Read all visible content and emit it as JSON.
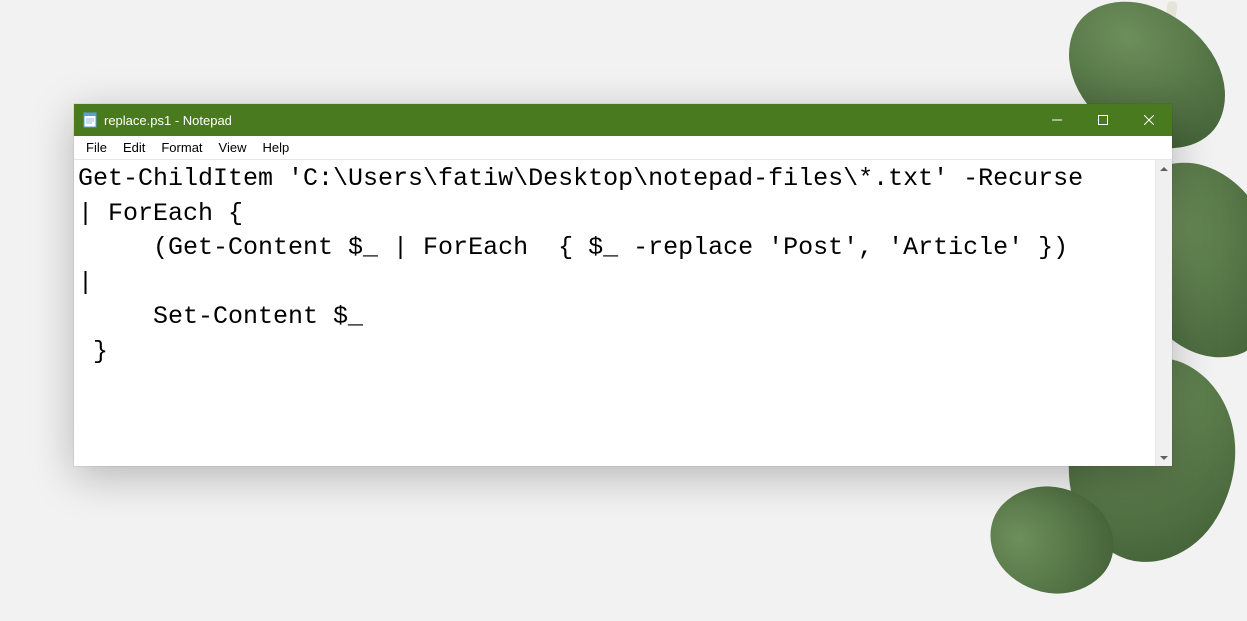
{
  "titlebar": {
    "title": "replace.ps1 - Notepad"
  },
  "menubar": {
    "items": [
      "File",
      "Edit",
      "Format",
      "View",
      "Help"
    ]
  },
  "editor": {
    "content": "Get-ChildItem 'C:\\Users\\fatiw\\Desktop\\notepad-files\\*.txt' -Recurse \n| ForEach {\n     (Get-Content $_ | ForEach  { $_ -replace 'Post', 'Article' }) \n|\n     Set-Content $_\n }"
  }
}
